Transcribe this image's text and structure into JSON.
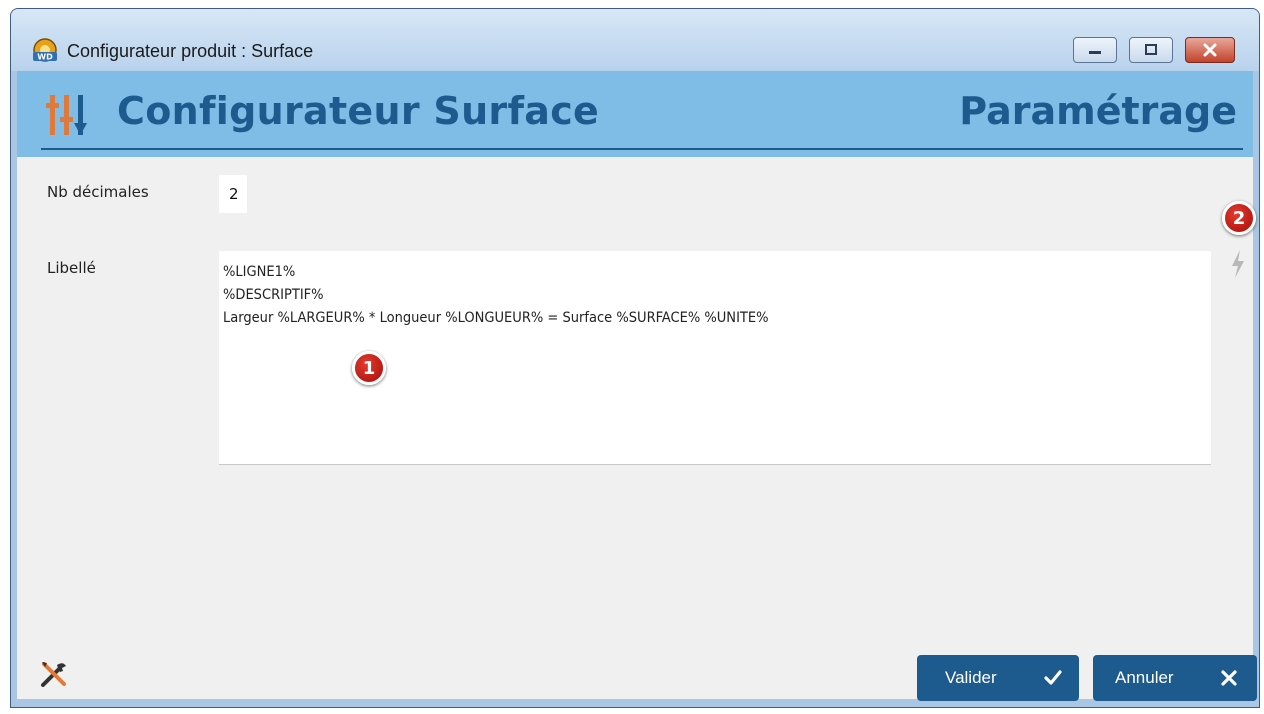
{
  "window": {
    "title": "Configurateur produit : Surface",
    "controls": [
      "minimize",
      "maximize",
      "close"
    ]
  },
  "header": {
    "title": "Configurateur Surface",
    "section": "Paramétrage",
    "icon": "sliders-icon",
    "accent_color": "#1d5a8e",
    "background_color": "#7fbde6"
  },
  "form": {
    "decimals_label": "Nb décimales",
    "decimals_value": "2",
    "label_label": "Libellé",
    "label_lines": [
      "%LIGNE1%",
      "%DESCRIPTIF%",
      "Largeur %LARGEUR% * Longueur %LONGUEUR% = Surface %SURFACE% %UNITE%"
    ]
  },
  "annotations": [
    {
      "number": "1"
    },
    {
      "number": "2"
    }
  ],
  "buttons": {
    "validate_label": "Valider",
    "validate_icon": "checkmark-icon",
    "cancel_label": "Annuler",
    "cancel_icon": "cross-icon"
  },
  "icons": {
    "bolt": "bolt-icon",
    "tools": "tools-icon"
  }
}
